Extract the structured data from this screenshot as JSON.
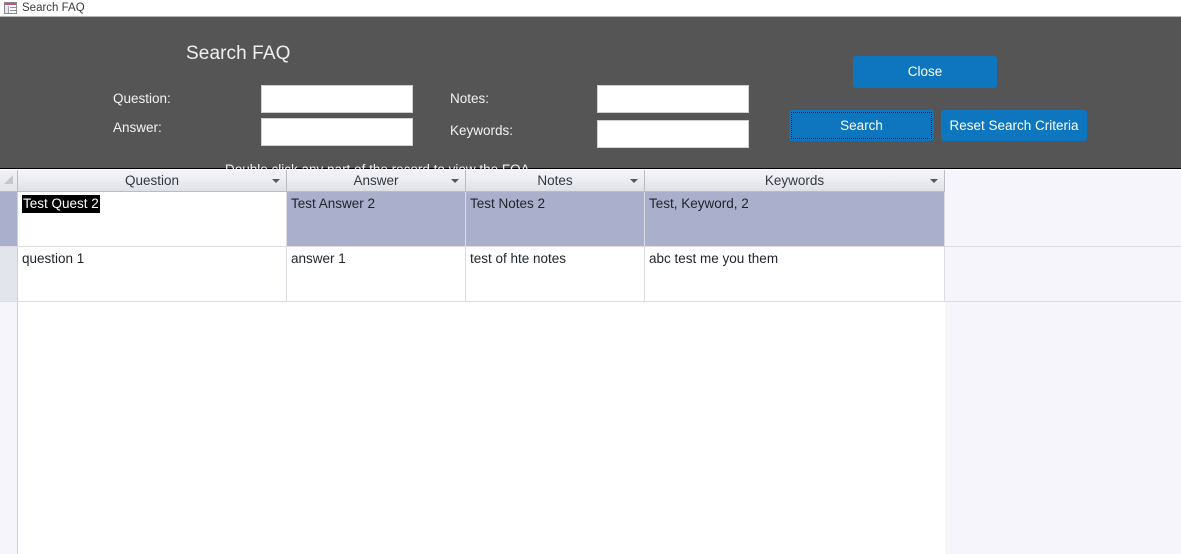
{
  "tab": {
    "label": "Search FAQ",
    "icon": "access-form-icon"
  },
  "form": {
    "title": "Search FAQ",
    "hint": "Double click any part of the record to view the FQA",
    "fields": {
      "question": {
        "label": "Question:",
        "value": "",
        "placeholder": ""
      },
      "answer": {
        "label": "Answer:",
        "value": "",
        "placeholder": ""
      },
      "notes": {
        "label": "Notes:",
        "value": "",
        "placeholder": ""
      },
      "keywords": {
        "label": "Keywords:",
        "value": "",
        "placeholder": ""
      }
    },
    "buttons": {
      "close": "Close",
      "search": "Search",
      "reset": "Reset Search Criteria"
    },
    "colors": {
      "header_bg": "#555555",
      "button_bg": "#0d76bf",
      "button_text": "#ffffff",
      "selection_bg": "#aab0cb",
      "edit_highlight_bg": "#000000"
    }
  },
  "datasheet": {
    "columns": [
      {
        "label": "Question",
        "sort_icon": "chevron-down-icon"
      },
      {
        "label": "Answer",
        "sort_icon": "chevron-down-icon"
      },
      {
        "label": "Notes",
        "sort_icon": "chevron-down-icon"
      },
      {
        "label": "Keywords",
        "sort_icon": "chevron-down-icon"
      }
    ],
    "rows": [
      {
        "selected": true,
        "editing_cell": 0,
        "cells": [
          "Test Quest 2",
          "Test Answer 2",
          "Test Notes 2",
          "Test, Keyword, 2"
        ]
      },
      {
        "selected": false,
        "editing_cell": -1,
        "cells": [
          "question 1",
          "answer 1",
          "test of hte notes",
          "abc test me you them"
        ]
      }
    ]
  }
}
